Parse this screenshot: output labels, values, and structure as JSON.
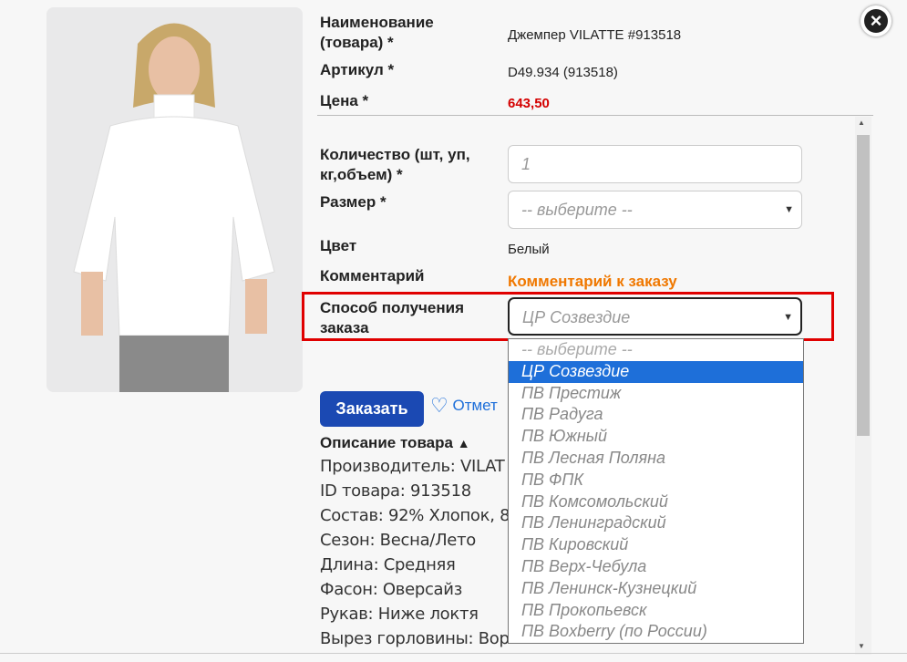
{
  "product": {
    "name_label": "Наименование (товара) *",
    "name_value": "Джемпер VILATTE #913518",
    "sku_label": "Артикул *",
    "sku_value": "D49.934 (913518)",
    "price_label": "Цена *",
    "price_value": "643,50",
    "image_icon": "product-photo-white-jumper"
  },
  "form": {
    "quantity_label": "Количество (шт, уп, кг,объем) *",
    "quantity_placeholder": "1",
    "size_label": "Размер *",
    "size_value": "-- выберите --",
    "color_label": "Цвет",
    "color_value": "Белый",
    "comment_label": "Комментарий",
    "comment_link": "Комментарий к заказу",
    "pickup_label": "Способ получения заказа",
    "pickup_value": "ЦР Созвездие"
  },
  "dropdown": {
    "options": [
      "-- выберите --",
      "ЦР Созвездие",
      "ПВ Престиж",
      "ПВ Радуга",
      "ПВ Южный",
      "ПВ Лесная Поляна",
      "ПВ ФПК",
      "ПВ Комсомольский",
      "ПВ Ленинградский",
      "ПВ Кировский",
      "ПВ Верх-Чебула",
      "ПВ Ленинск-Кузнецкий",
      "ПВ Прокопьевск",
      "ПВ Boxberry (по России)"
    ],
    "selected_index": 1
  },
  "actions": {
    "order_label": "Заказать",
    "favorite_label": "Отмет"
  },
  "description": {
    "heading": "Описание товара",
    "lines": [
      "Производитель: VILAT",
      "ID товара: 913518",
      "Состав: 92% Хлопок, 8",
      "Сезон: Весна/Лето",
      "Длина: Средняя",
      "Фасон: Оверсайз",
      "Рукав: Ниже локтя",
      "Вырез горловины: Вор"
    ]
  },
  "colors": {
    "accent": "#1e6fd9",
    "order_button": "#1b49b3",
    "price": "#d40000",
    "comment_link": "#f07800",
    "highlight": "#e00000"
  }
}
